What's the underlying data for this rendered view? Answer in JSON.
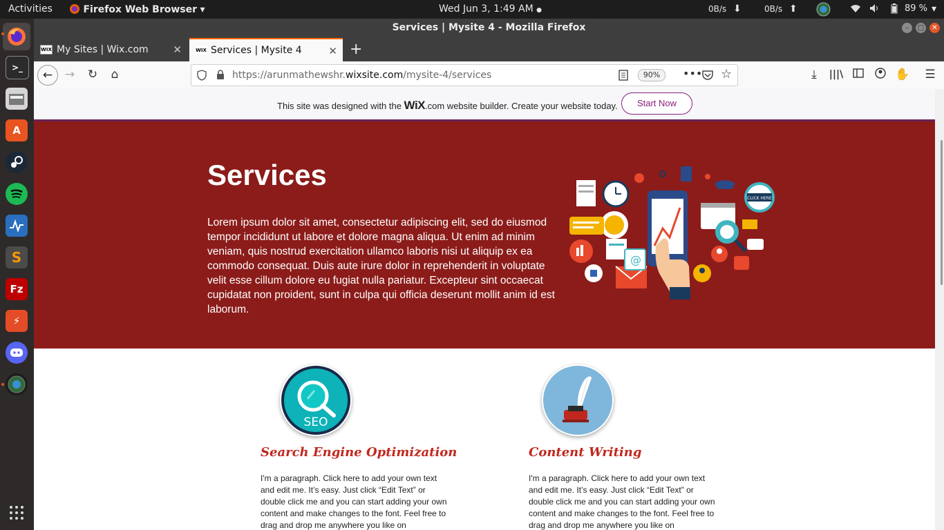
{
  "topbar": {
    "activities": "Activities",
    "app_name": "Firefox Web Browser",
    "clock": "Wed Jun  3,  1:49 AM",
    "net_down": "0B/s",
    "net_up": "0B/s",
    "battery": "89 %"
  },
  "window": {
    "title": "Services | Mysite 4 - Mozilla Firefox"
  },
  "tabs": [
    {
      "label": "My Sites | Wix.com",
      "favicon": "WIX"
    },
    {
      "label": "Services | Mysite 4",
      "favicon": "WIX"
    }
  ],
  "navbar": {
    "url_prefix": "https://arunmathewshr.",
    "url_domain": "wixsite.com",
    "url_path": "/mysite-4/services",
    "zoom": "90%"
  },
  "wix_banner": {
    "text_before": "This site was designed with the ",
    "logo": "WiX",
    "logo_suffix": ".com",
    "text_after": " website builder. Create your website today.",
    "button": "Start Now"
  },
  "hero": {
    "title": "Services",
    "body": "Lorem ipsum dolor sit amet, consectetur adipiscing elit, sed do eiusmod tempor incididunt ut labore et dolore magna aliqua. Ut enim ad minim veniam, quis nostrud exercitation ullamco laboris nisi ut aliquip ex ea commodo consequat. Duis aute irure dolor in reprehenderit in voluptate velit esse cillum dolore eu fugiat nulla pariatur. Excepteur sint occaecat cupidatat non proident, sunt in culpa qui officia deserunt mollit anim id est laborum.",
    "illustration_label": "CLICK HERE"
  },
  "services": [
    {
      "title": "Search Engine Optimization",
      "icon_label": "SEO",
      "text": "I'm a paragraph. Click here to add your own text and edit me. It’s easy. Just click “Edit Text” or double click me and you can start adding your own content and make changes to the font. Feel free to drag and drop me anywhere you like on"
    },
    {
      "title": "Content Writing",
      "text": "I'm a paragraph. Click here to add your own text and edit me. It’s easy. Just click “Edit Text” or double click me and you can start adding your own content and make changes to the font. Feel free to drag and drop me anywhere you like on"
    }
  ],
  "colors": {
    "hero_bg": "#8b1c1a",
    "service_title": "#c0281f",
    "wix_accent": "#8a1f7d"
  }
}
